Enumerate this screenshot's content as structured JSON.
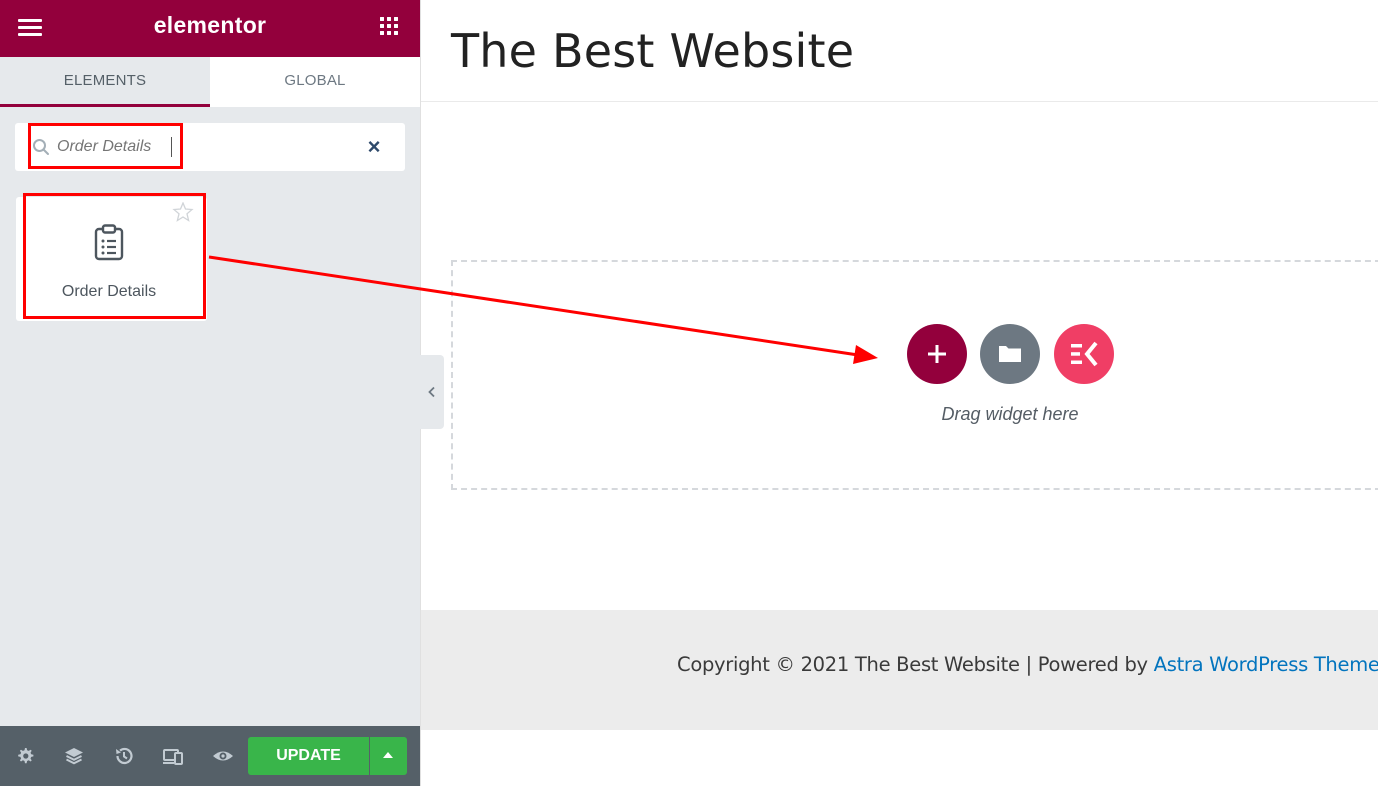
{
  "sidebar": {
    "brand": "elementor",
    "tabs": [
      {
        "label": "ELEMENTS",
        "active": true
      },
      {
        "label": "GLOBAL",
        "active": false
      }
    ],
    "search": {
      "value": "",
      "placeholder": "Order Details",
      "clear_icon": "close-icon"
    },
    "widgets": [
      {
        "label": "Order Details",
        "icon": "clipboard-list-icon",
        "pro": true
      }
    ],
    "bottom": {
      "icons": [
        "settings-icon",
        "layers-icon",
        "history-icon",
        "responsive-icon",
        "preview-eye-icon"
      ],
      "update_label": "UPDATE"
    }
  },
  "canvas": {
    "site_title": "The Best Website",
    "drop_zone": {
      "buttons": [
        "add-section-icon",
        "add-template-icon",
        "elementskit-icon"
      ],
      "hint": "Drag widget here"
    },
    "footer": {
      "text": "Copyright © 2021 The Best Website | Powered by ",
      "link": "Astra WordPress Theme"
    }
  },
  "colors": {
    "brand": "#93003c",
    "update": "#39b54a",
    "annotation": "#ff0000",
    "ek": "#f03e65",
    "link": "#0274be"
  }
}
